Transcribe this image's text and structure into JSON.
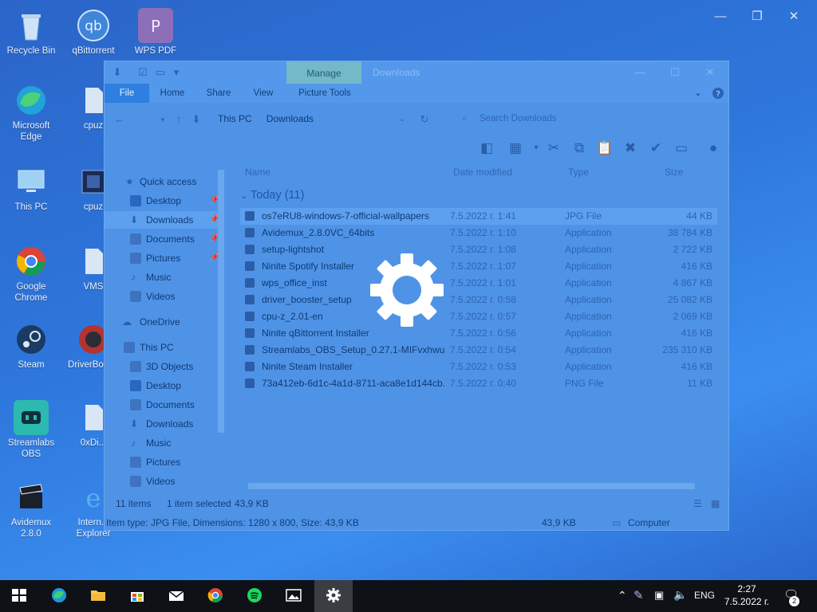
{
  "desktop_icons": [
    {
      "label": "Recycle Bin"
    },
    {
      "label": "qBittorrent"
    },
    {
      "label": "WPS PDF"
    },
    {
      "label": "Microsoft Edge"
    },
    {
      "label": "cpuz"
    },
    {
      "label": "This PC"
    },
    {
      "label": "cpuz"
    },
    {
      "label": "Google Chrome"
    },
    {
      "label": "VMS"
    },
    {
      "label": "Steam"
    },
    {
      "label": "DriverBo... 9"
    },
    {
      "label": "Streamlabs OBS"
    },
    {
      "label": "0xDi..."
    },
    {
      "label": "Avidemux 2.8.0"
    },
    {
      "label": "Intern... Explorer"
    }
  ],
  "explorer": {
    "manage_tab": "Manage",
    "title": "Downloads",
    "ribbon_tabs": [
      "File",
      "Home",
      "Share",
      "View",
      "Picture Tools"
    ],
    "breadcrumb": [
      "This PC",
      "Downloads"
    ],
    "search_placeholder": "Search Downloads",
    "nav": {
      "quick_access": "Quick access",
      "quick_items": [
        "Desktop",
        "Downloads",
        "Documents",
        "Pictures",
        "Music",
        "Videos"
      ],
      "onedrive": "OneDrive",
      "this_pc": "This PC",
      "pc_items": [
        "3D Objects",
        "Desktop",
        "Documents",
        "Downloads",
        "Music",
        "Pictures",
        "Videos"
      ]
    },
    "columns": {
      "name": "Name",
      "date": "Date modified",
      "type": "Type",
      "size": "Size"
    },
    "group": "Today (11)",
    "files": [
      {
        "name": "os7eRU8-windows-7-official-wallpapers",
        "date": "7.5.2022 г. 1:41",
        "type": "JPG File",
        "size": "44 KB"
      },
      {
        "name": "Avidemux_2.8.0VC_64bits",
        "date": "7.5.2022 г. 1:10",
        "type": "Application",
        "size": "38 784 KB"
      },
      {
        "name": "setup-lightshot",
        "date": "7.5.2022 г. 1:08",
        "type": "Application",
        "size": "2 722 KB"
      },
      {
        "name": "Ninite Spotify Installer",
        "date": "7.5.2022 г. 1:07",
        "type": "Application",
        "size": "416 KB"
      },
      {
        "name": "wps_office_inst",
        "date": "7.5.2022 г. 1:01",
        "type": "Application",
        "size": "4 867 KB"
      },
      {
        "name": "driver_booster_setup",
        "date": "7.5.2022 г. 0:58",
        "type": "Application",
        "size": "25 082 KB"
      },
      {
        "name": "cpu-z_2.01-en",
        "date": "7.5.2022 г. 0:57",
        "type": "Application",
        "size": "2 069 KB"
      },
      {
        "name": "Ninite qBittorrent Installer",
        "date": "7.5.2022 г. 0:56",
        "type": "Application",
        "size": "416 KB"
      },
      {
        "name": "Streamlabs_OBS_Setup_0.27.1-MIFvxhwu...",
        "date": "7.5.2022 г. 0:54",
        "type": "Application",
        "size": "235 310 KB"
      },
      {
        "name": "Ninite Steam Installer",
        "date": "7.5.2022 г. 0:53",
        "type": "Application",
        "size": "416 KB"
      },
      {
        "name": "73a412eb-6d1c-4a1d-8711-aca8e1d144cb...",
        "date": "7.5.2022 г. 0:40",
        "type": "PNG File",
        "size": "11 KB"
      }
    ],
    "status": {
      "count": "11 items",
      "selected": "1 item selected",
      "selected_size": "43,9 KB",
      "details": "Item type: JPG File, Dimensions: 1280 x 800, Size: 43,9 KB",
      "size": "43,9 KB",
      "location": "Computer"
    }
  },
  "tray": {
    "language": "ENG",
    "time": "2:27",
    "date": "7.5.2022 г.",
    "notifications": "2"
  },
  "colors": {
    "desktop": "#2e77dc",
    "overlay_window": "#4f93e6",
    "taskbar": "#0e1116"
  }
}
